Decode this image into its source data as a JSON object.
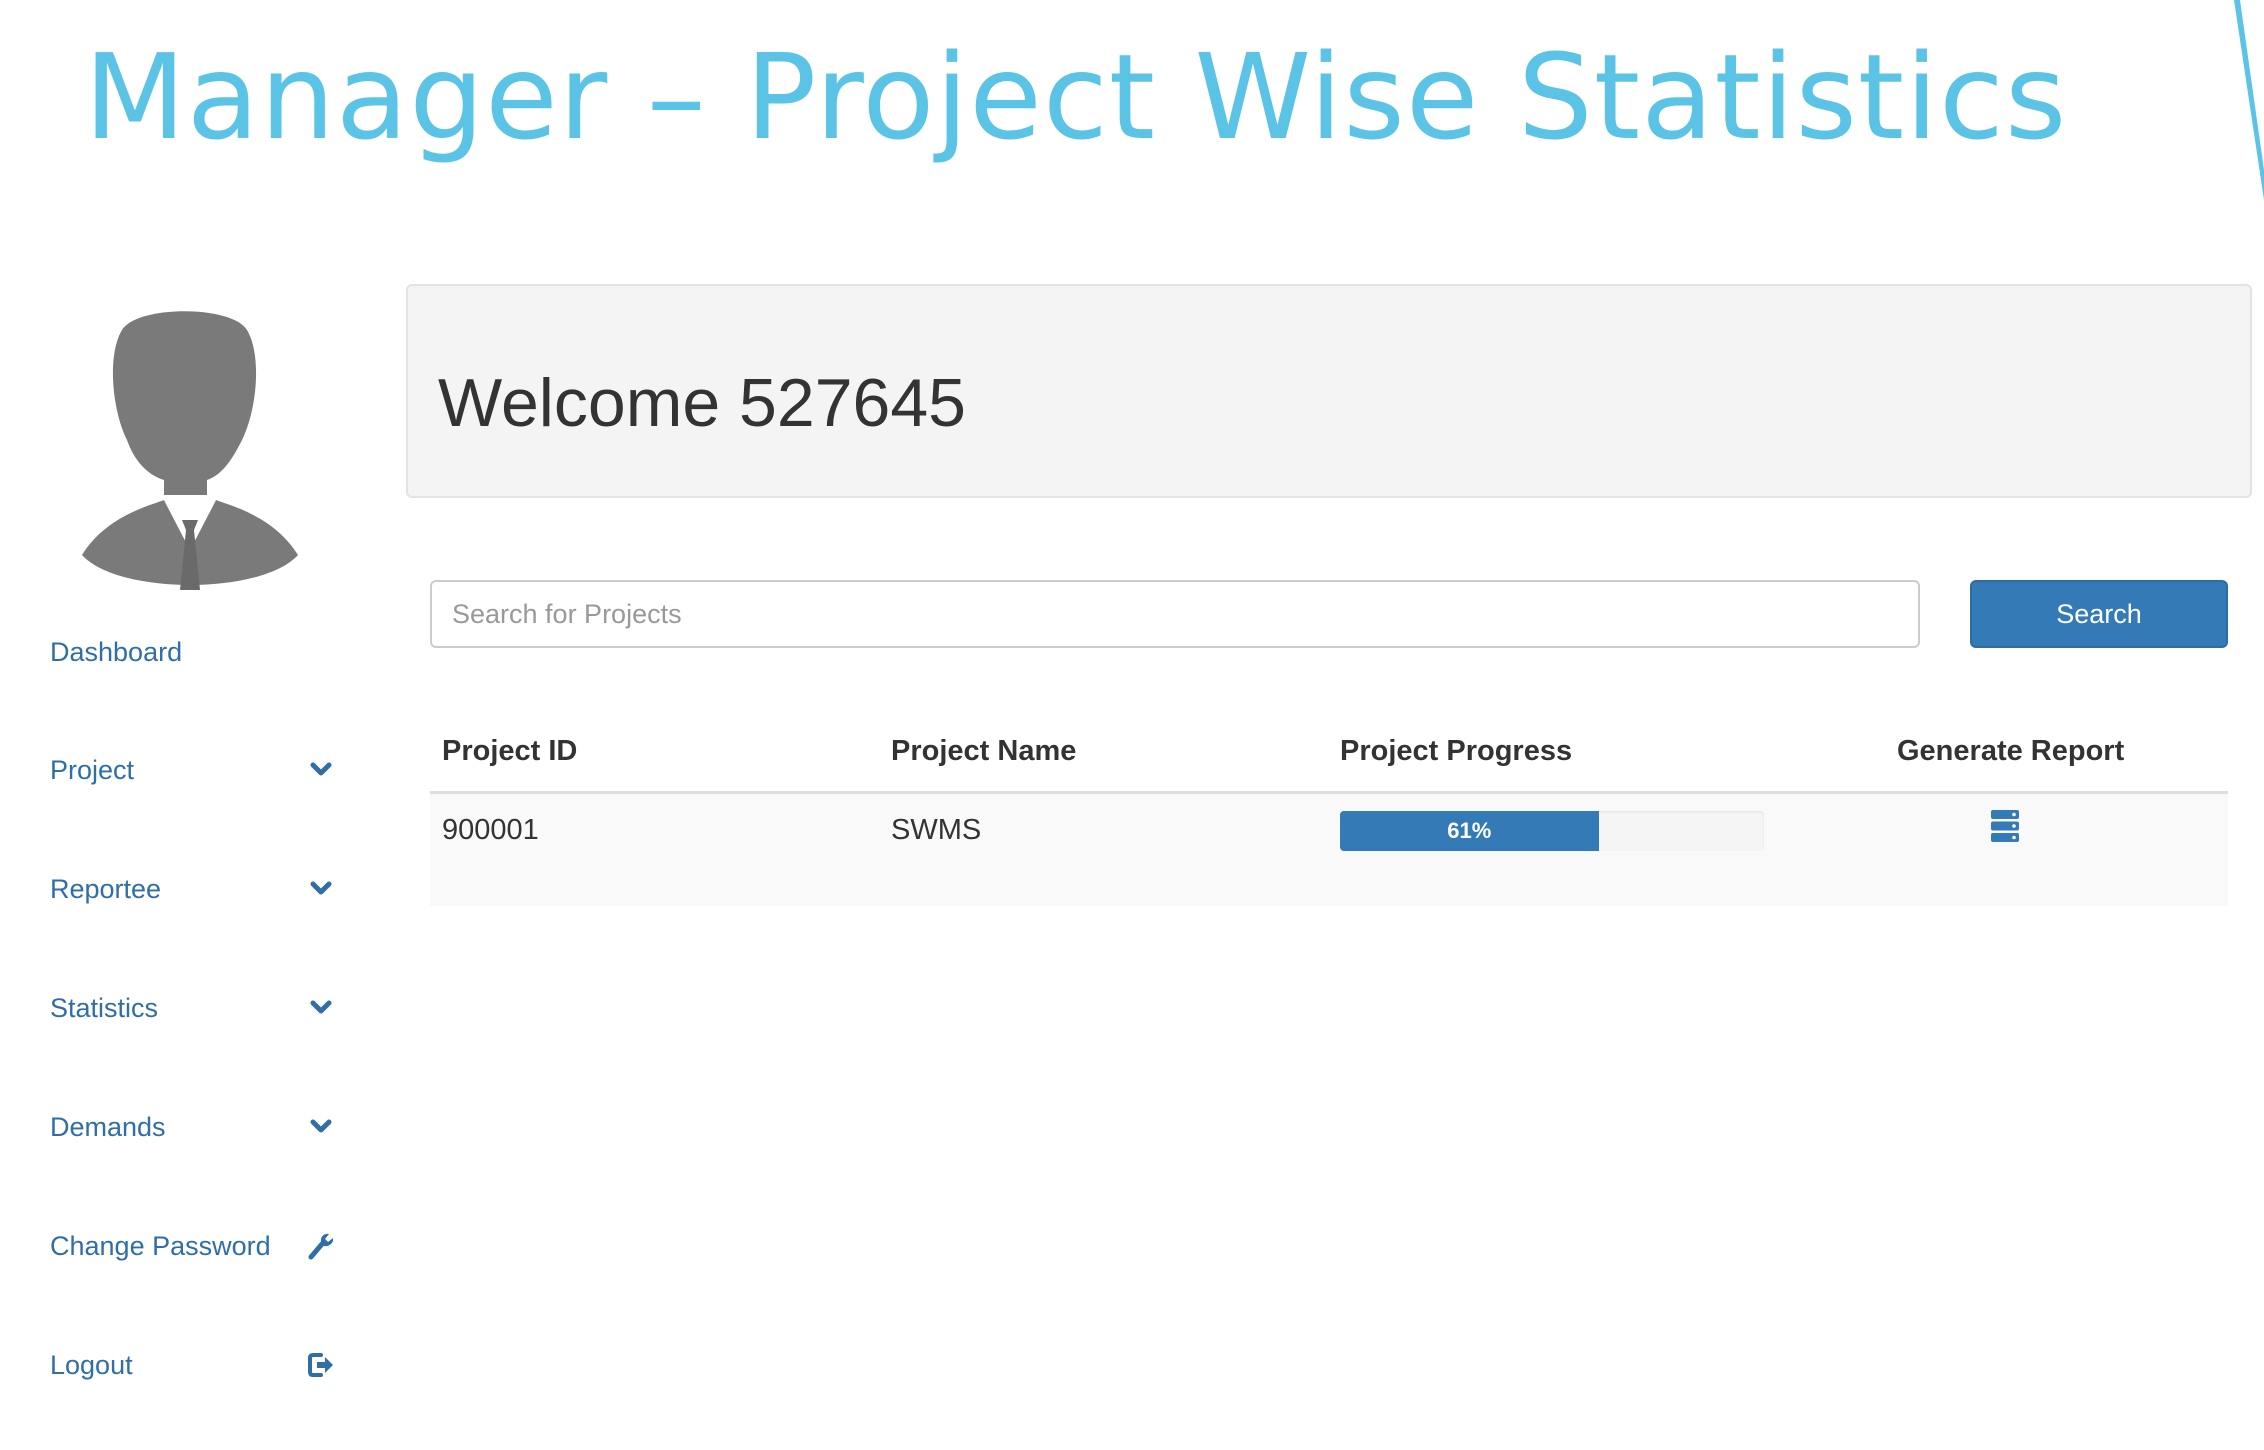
{
  "slide_title": "Manager – Project Wise Statistics",
  "accent_color": "#5bc4e6",
  "brand_color": "#337ab7",
  "sidebar": {
    "items": [
      {
        "label": "Dashboard",
        "icon": ""
      },
      {
        "label": "Project",
        "icon": "chevron-down-icon"
      },
      {
        "label": "Reportee",
        "icon": "chevron-down-icon"
      },
      {
        "label": "Statistics",
        "icon": "chevron-down-icon"
      },
      {
        "label": "Demands",
        "icon": "chevron-down-icon"
      },
      {
        "label": "Change Password",
        "icon": "wrench-icon"
      },
      {
        "label": "Logout",
        "icon": "logout-icon"
      }
    ]
  },
  "welcome": {
    "text": "Welcome 527645"
  },
  "search": {
    "placeholder": "Search for Projects",
    "value": "",
    "button_label": "Search"
  },
  "table": {
    "headers": [
      "Project ID",
      "Project Name",
      "Project Progress",
      "Generate Report"
    ],
    "rows": [
      {
        "project_id": "900001",
        "project_name": "SWMS",
        "progress": 61,
        "progress_label": "61%",
        "report_icon": "report-icon"
      }
    ]
  }
}
